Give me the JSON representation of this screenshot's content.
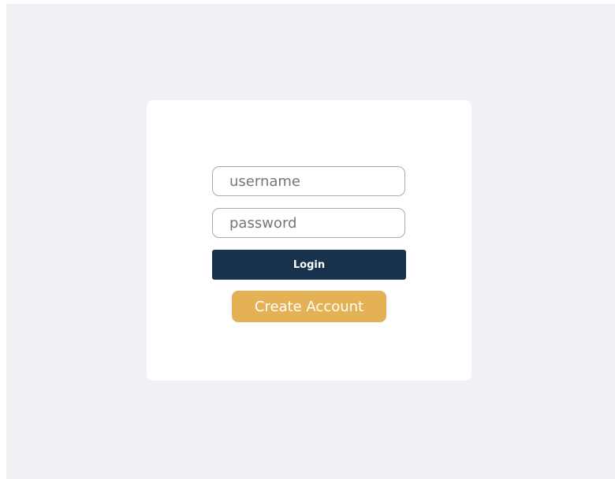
{
  "login_form": {
    "username": {
      "value": "",
      "placeholder": "username"
    },
    "password": {
      "value": "",
      "placeholder": "password"
    },
    "login_label": "Login",
    "create_account_label": "Create Account"
  },
  "colors": {
    "page_background": "#eff1f5",
    "card_background": "#ffffff",
    "login_button": "#17324d",
    "create_account_button": "#e4b254",
    "input_border": "#a9a9a9"
  }
}
